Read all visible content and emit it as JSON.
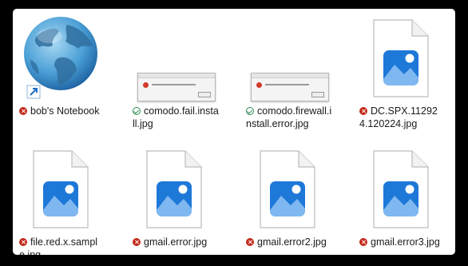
{
  "files": [
    {
      "name": "bob's Notebook",
      "status": "error",
      "type": "network-globe-shortcut"
    },
    {
      "name": "comodo.fail.install.jpg",
      "status": "ok",
      "type": "screenshot-thumbnail"
    },
    {
      "name": "comodo.firewall.install.error.jpg",
      "status": "ok",
      "type": "screenshot-thumbnail"
    },
    {
      "name": "DC.SPX.112924.120224.jpg",
      "status": "error",
      "type": "image-file"
    },
    {
      "name": "file.red.x.sample.jpg",
      "status": "error",
      "type": "image-file"
    },
    {
      "name": "gmail.error.jpg",
      "status": "error",
      "type": "image-file"
    },
    {
      "name": "gmail.error2.jpg",
      "status": "error",
      "type": "image-file"
    },
    {
      "name": "gmail.error3.jpg",
      "status": "error",
      "type": "image-file"
    }
  ],
  "colors": {
    "error": "#c42b1c",
    "ok": "#2e8b57",
    "photo_icon_blue": "#1e78d8"
  }
}
